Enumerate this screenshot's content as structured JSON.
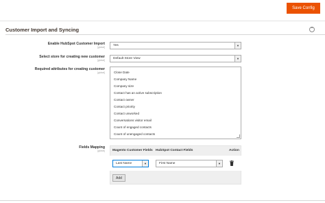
{
  "toolbar": {
    "save_label": "Save Config"
  },
  "section": {
    "title": "Customer Import and Syncing"
  },
  "fields": {
    "enable_import": {
      "label": "Enable HubSpot Customer Import",
      "scope": "[global]",
      "value": "Yes"
    },
    "store": {
      "label": "Select store for creating new customer",
      "scope": "[global]",
      "value": "Default Store View"
    },
    "required_attrs": {
      "label": "Required attributes for creating customer",
      "scope": "[global]",
      "options": [
        "Close Date",
        "Company Name",
        "Company size",
        "Contact has an active subscription",
        "Contact owner",
        "Contact priority",
        "Contact unworked",
        "Conversations visitor email",
        "Count of engaged contacts",
        "Count of unengaged contacts"
      ]
    },
    "mapping": {
      "label": "Fields Mapping",
      "scope": "[global]",
      "headers": {
        "magento": "Magento Customer Fields",
        "hubspot": "HubSpot Contact Fields",
        "action": "Action"
      },
      "row": {
        "magento": "Last Name",
        "hubspot": "First Name"
      },
      "add_label": "Add"
    }
  },
  "icons": {
    "collapse": "collapse-circle-icon",
    "delete": "trash-icon",
    "dropdown": "chevron-down-icon"
  },
  "colors": {
    "accent": "#eb5202",
    "focus": "#007bdb"
  }
}
